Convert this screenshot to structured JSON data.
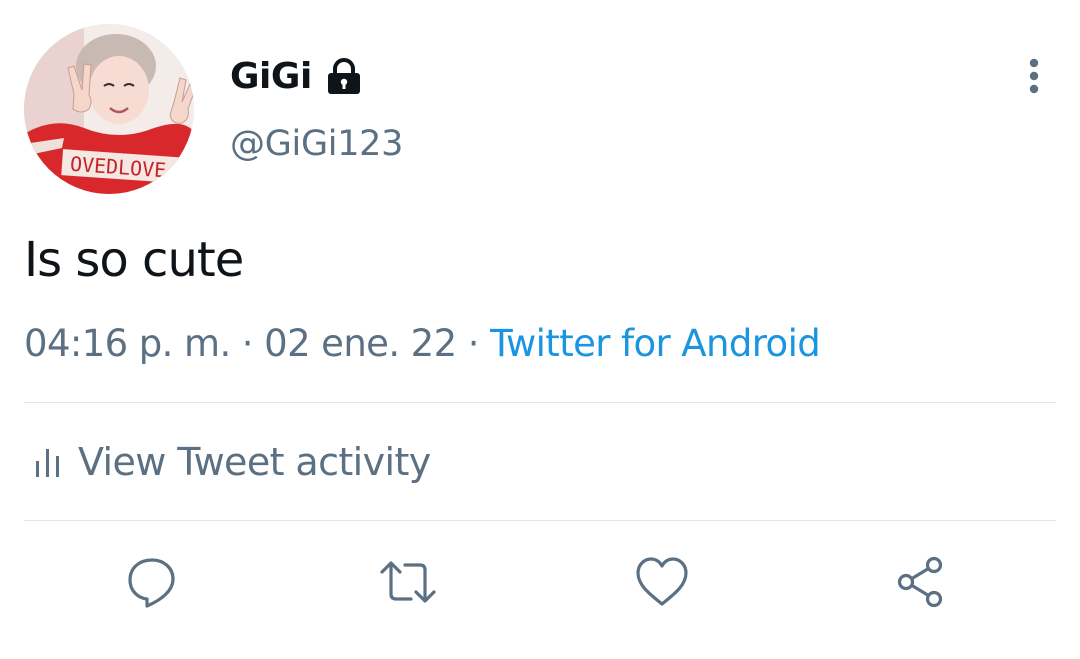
{
  "tweet": {
    "display_name": "GiGi",
    "handle": "@GiGi123",
    "text": "Is so cute",
    "time": "04:16 p. m.",
    "date": "02 ene. 22",
    "separator": "·",
    "source": "Twitter for Android",
    "avatar_shirt_text": "OVEDLOVE"
  },
  "activity": {
    "label": "View Tweet activity"
  },
  "actions": {
    "reply": "reply-icon",
    "retweet": "retweet-icon",
    "like": "heart-icon",
    "share": "share-icon"
  },
  "colors": {
    "text": "#0f1419",
    "secondary": "#5b7083",
    "link": "#1b95e0",
    "divider": "#e1e6ea"
  }
}
